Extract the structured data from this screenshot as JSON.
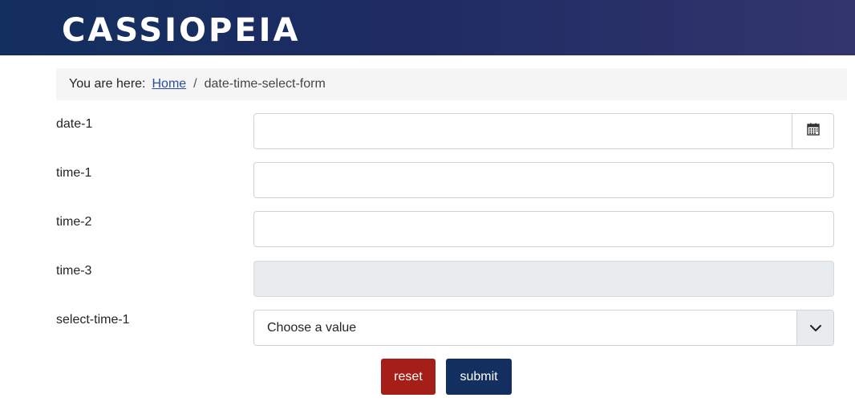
{
  "header": {
    "brand": "CASSIOPEIA"
  },
  "breadcrumb": {
    "label": "You are here:",
    "home": "Home",
    "separator": "/",
    "current": "date-time-select-form"
  },
  "form": {
    "date_1": {
      "label": "date-1",
      "value": ""
    },
    "time_1": {
      "label": "time-1",
      "value": ""
    },
    "time_2": {
      "label": "time-2",
      "value": ""
    },
    "time_3": {
      "label": "time-3",
      "value": "",
      "disabled": true
    },
    "select_time_1": {
      "label": "select-time-1",
      "selected": "Choose a value"
    }
  },
  "buttons": {
    "reset": "reset",
    "submit": "submit"
  },
  "icons": {
    "date_picker": "calendar-icon",
    "select_toggle": "chevron-down-icon"
  },
  "colors": {
    "header": "#1d2b62",
    "reset": "#a51f18",
    "submit": "#132f5f",
    "link": "#2a4e9e"
  }
}
